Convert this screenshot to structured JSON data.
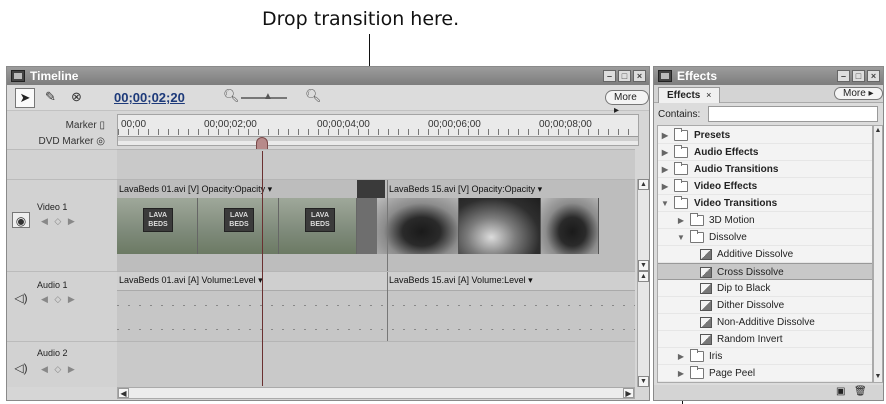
{
  "callouts": {
    "top": "Drop transition here."
  },
  "timeline": {
    "title": "Timeline",
    "timecode": "00;00;02;20",
    "more_label": "More ▸",
    "marker_label": "Marker",
    "dvd_marker_label": "DVD Marker",
    "ruler_ticks": [
      "00;00",
      "00;00;02;00",
      "00;00;04;00",
      "00;00;06;00",
      "00;00;08;00"
    ],
    "tracks": {
      "video1": {
        "name": "Video 1",
        "clip1_label": "LavaBeds 01.avi [V] Opacity:Opacity ▾",
        "clip2_label": "LavaBeds 15.avi [V] Opacity:Opacity ▾",
        "thumb_text": "LAVA BEDS"
      },
      "audio1": {
        "name": "Audio 1",
        "clip1_label": "LavaBeds 01.avi [A] Volume:Level ▾",
        "clip2_label": "LavaBeds 15.avi [A] Volume:Level ▾"
      },
      "audio2": {
        "name": "Audio 2"
      }
    }
  },
  "effects": {
    "title": "Effects",
    "tab_label": "Effects",
    "more_label": "More ▸",
    "contains_label": "Contains:",
    "contains_value": "",
    "items": [
      {
        "label": "Presets",
        "expanded": false
      },
      {
        "label": "Audio Effects",
        "expanded": false
      },
      {
        "label": "Audio Transitions",
        "expanded": false
      },
      {
        "label": "Video Effects",
        "expanded": false
      },
      {
        "label": "Video Transitions",
        "expanded": true
      },
      {
        "label": "3D Motion",
        "expanded": false
      },
      {
        "label": "Dissolve",
        "expanded": true
      },
      {
        "label": "Additive Dissolve"
      },
      {
        "label": "Cross Dissolve",
        "selected": true
      },
      {
        "label": "Dip to Black"
      },
      {
        "label": "Dither Dissolve"
      },
      {
        "label": "Non-Additive Dissolve"
      },
      {
        "label": "Random Invert"
      },
      {
        "label": "Iris",
        "expanded": false
      },
      {
        "label": "Page Peel",
        "expanded": false
      }
    ]
  }
}
